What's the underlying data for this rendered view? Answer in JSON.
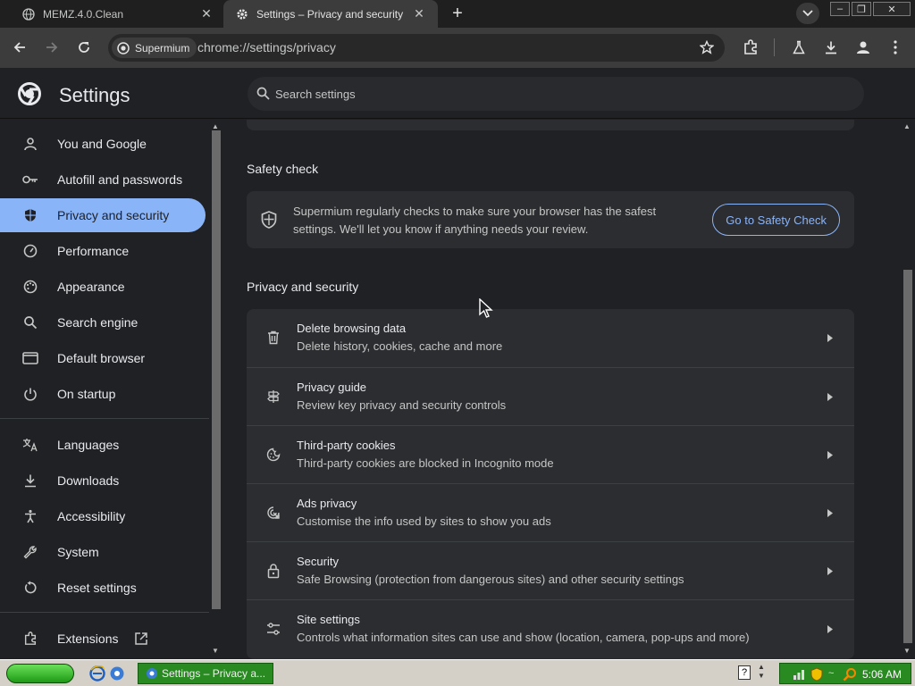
{
  "tabs": [
    {
      "title": "MEMZ.4.0.Clean",
      "icon": "globe-icon",
      "active": false
    },
    {
      "title": "Settings – Privacy and security",
      "icon": "gear-icon",
      "active": true
    }
  ],
  "window_controls": {
    "minimize": "–",
    "maximize": "❐",
    "close": "✕"
  },
  "toolbar": {
    "site_chip_label": "Supermium",
    "url": "chrome://settings/privacy"
  },
  "header": {
    "title": "Settings",
    "search_placeholder": "Search settings"
  },
  "sidebar": {
    "items": [
      {
        "label": "You and Google",
        "icon": "person-icon"
      },
      {
        "label": "Autofill and passwords",
        "icon": "key-icon"
      },
      {
        "label": "Privacy and security",
        "icon": "shield-icon",
        "selected": true
      },
      {
        "label": "Performance",
        "icon": "speedometer-icon"
      },
      {
        "label": "Appearance",
        "icon": "palette-icon"
      },
      {
        "label": "Search engine",
        "icon": "search-icon"
      },
      {
        "label": "Default browser",
        "icon": "browser-window-icon"
      },
      {
        "label": "On startup",
        "icon": "power-icon"
      }
    ],
    "items2": [
      {
        "label": "Languages",
        "icon": "translate-icon"
      },
      {
        "label": "Downloads",
        "icon": "download-icon"
      },
      {
        "label": "Accessibility",
        "icon": "accessibility-icon"
      },
      {
        "label": "System",
        "icon": "wrench-icon"
      },
      {
        "label": "Reset settings",
        "icon": "reset-icon"
      }
    ],
    "extensions_label": "Extensions"
  },
  "safety_check": {
    "section_title": "Safety check",
    "text": "Supermium regularly checks to make sure your browser has the safest settings. We'll let you know if anything needs your review.",
    "button_label": "Go to Safety Check"
  },
  "privacy": {
    "section_title": "Privacy and security",
    "rows": [
      {
        "title": "Delete browsing data",
        "subtitle": "Delete history, cookies, cache and more",
        "icon": "trash-icon"
      },
      {
        "title": "Privacy guide",
        "subtitle": "Review key privacy and security controls",
        "icon": "signpost-icon"
      },
      {
        "title": "Third-party cookies",
        "subtitle": "Third-party cookies are blocked in Incognito mode",
        "icon": "cookie-icon"
      },
      {
        "title": "Ads privacy",
        "subtitle": "Customise the info used by sites to show you ads",
        "icon": "ads-target-icon"
      },
      {
        "title": "Security",
        "subtitle": "Safe Browsing (protection from dangerous sites) and other security settings",
        "icon": "lock-icon"
      },
      {
        "title": "Site settings",
        "subtitle": "Controls what information sites can use and show (location, camera, pop-ups and more)",
        "icon": "sliders-icon"
      }
    ]
  },
  "taskbar": {
    "task_label": "Settings – Privacy a...",
    "clock": "5:06 AM"
  }
}
